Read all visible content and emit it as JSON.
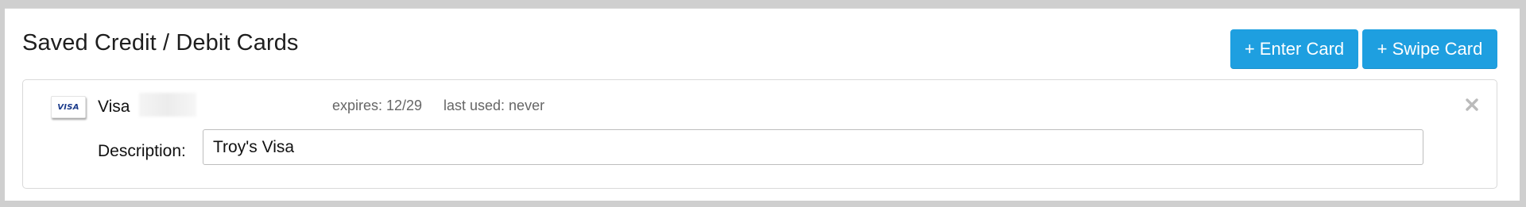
{
  "header": {
    "title": "Saved Credit / Debit Cards",
    "enter_card_label": "+ Enter Card",
    "swipe_card_label": "+ Swipe Card"
  },
  "colors": {
    "accent": "#1e9fe0",
    "meta_text": "#666666",
    "close_icon": "#bbbbbb"
  },
  "cards": [
    {
      "logo_text": "VISA",
      "logo_icon": "visa-card-icon",
      "brand": "Visa",
      "expires": "expires: 12/29",
      "last_used": "last used: never",
      "description_label": "Description:",
      "description_value": "Troy's Visa",
      "remove_icon": "close-icon"
    }
  ]
}
